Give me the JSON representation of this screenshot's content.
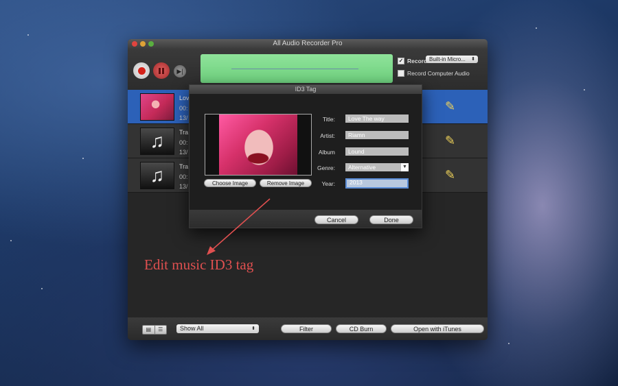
{
  "window": {
    "title": "All Audio Recorder Pro"
  },
  "toolbar": {
    "record_label": "Record",
    "record_checked": "✓",
    "mic_source": "Built-in Micro...",
    "computer_audio_label": "Record Computer Audio",
    "next_glyph": "▶|"
  },
  "tracks": [
    {
      "title": "Lov",
      "line2": "00:",
      "line3": "13/",
      "selected": true
    },
    {
      "title": "Tra",
      "line2": "00:",
      "line3": "13/"
    },
    {
      "title": "Tra",
      "line2": "00:",
      "line3": "13/"
    }
  ],
  "bottom": {
    "filter_select": "Show All",
    "filter_button": "Filter",
    "cd_burn_button": "CD Burn",
    "itunes_button": "Open with iTunes"
  },
  "dialog": {
    "title": "ID3 Tag",
    "choose_image": "Choose Image",
    "remove_image": "Remove Image",
    "fields": {
      "title_label": "Title:",
      "title_value": "Love The way",
      "artist_label": "Artist:",
      "artist_value": "Riamn",
      "album_label": "Album",
      "album_value": "Lound",
      "genre_label": "Genre:",
      "genre_value": "Alternative",
      "year_label": "Year:",
      "year_value": "2013"
    },
    "cancel": "Cancel",
    "done": "Done"
  },
  "annotation": {
    "text": "Edit music ID3 tag",
    "color": "#e05050"
  },
  "icons": {
    "music_note": "♫",
    "pencil": "✎",
    "select_arrow": "⬍",
    "dropdown_arrow": "▼",
    "view_grid": "▤",
    "view_list": "☰"
  }
}
